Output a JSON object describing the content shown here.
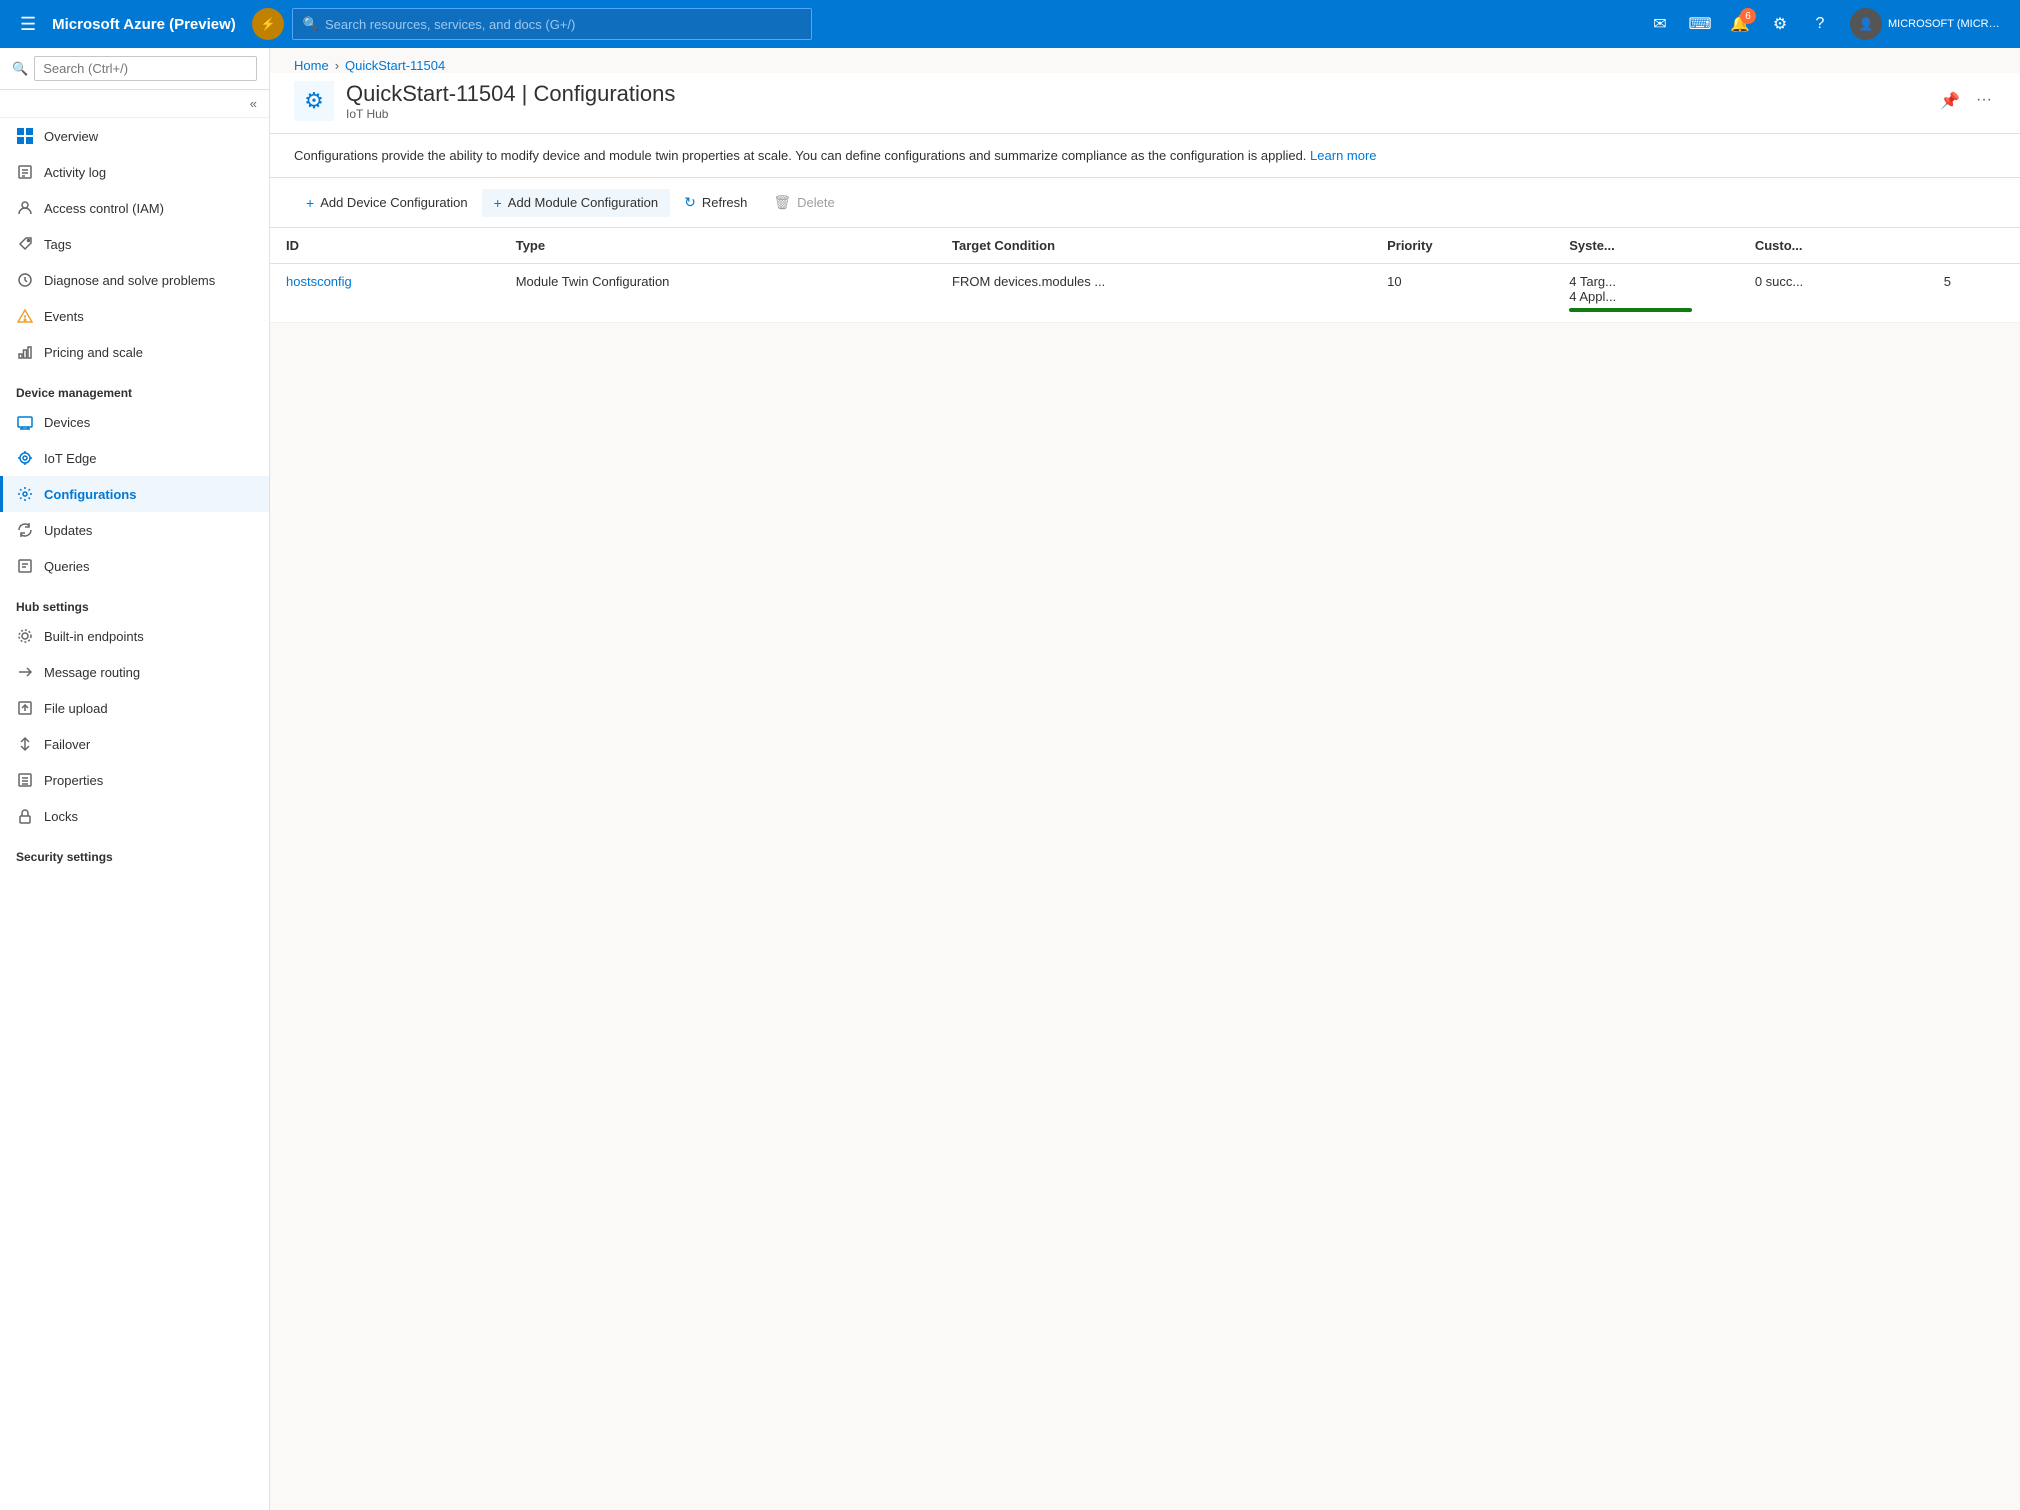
{
  "topnav": {
    "brand": "Microsoft Azure (Preview)",
    "search_placeholder": "Search resources, services, and docs (G+/)",
    "notification_count": "6",
    "user_label": "MICROSOFT (MICROSOFT.ON"
  },
  "breadcrumb": {
    "home": "Home",
    "resource": "QuickStart-11504"
  },
  "page": {
    "title": "QuickStart-11504 | Configurations",
    "subtitle": "IoT Hub"
  },
  "info": {
    "text": "Configurations provide the ability to modify device and module twin properties at scale. You can define configurations and summarize compliance as the configuration is applied.",
    "learn_more": "Learn more"
  },
  "toolbar": {
    "add_device_config": "Add Device Configuration",
    "add_module_config": "Add Module Configuration",
    "refresh": "Refresh",
    "delete": "Delete"
  },
  "table": {
    "columns": [
      "ID",
      "Type",
      "Target Condition",
      "Priority",
      "Syste...",
      "Custo...",
      ""
    ],
    "rows": [
      {
        "id": "hostsconfig",
        "type": "Module Twin Configuration",
        "target_condition": "FROM devices.modules ...",
        "priority": "10",
        "syste_line1": "4 Targ...",
        "syste_line2": "4 Appl...",
        "custo": "0 succ...",
        "extra": "5"
      }
    ]
  },
  "sidebar": {
    "search_placeholder": "Search (Ctrl+/)",
    "items": [
      {
        "id": "overview",
        "label": "Overview",
        "icon": "⊞"
      },
      {
        "id": "activity-log",
        "label": "Activity log",
        "icon": "📋"
      },
      {
        "id": "access-control",
        "label": "Access control (IAM)",
        "icon": "👥"
      },
      {
        "id": "tags",
        "label": "Tags",
        "icon": "🏷"
      },
      {
        "id": "diagnose",
        "label": "Diagnose and solve problems",
        "icon": "🔧"
      },
      {
        "id": "events",
        "label": "Events",
        "icon": "⚡"
      },
      {
        "id": "pricing",
        "label": "Pricing and scale",
        "icon": "📊"
      }
    ],
    "section_device": "Device management",
    "device_items": [
      {
        "id": "devices",
        "label": "Devices",
        "icon": "🖥"
      },
      {
        "id": "iot-edge",
        "label": "IoT Edge",
        "icon": "☁"
      },
      {
        "id": "configurations",
        "label": "Configurations",
        "icon": "⚙",
        "active": true
      },
      {
        "id": "updates",
        "label": "Updates",
        "icon": "🔄"
      },
      {
        "id": "queries",
        "label": "Queries",
        "icon": "📄"
      }
    ],
    "section_hub": "Hub settings",
    "hub_items": [
      {
        "id": "built-in-endpoints",
        "label": "Built-in endpoints",
        "icon": "🔌"
      },
      {
        "id": "message-routing",
        "label": "Message routing",
        "icon": "↗"
      },
      {
        "id": "file-upload",
        "label": "File upload",
        "icon": "📁"
      },
      {
        "id": "failover",
        "label": "Failover",
        "icon": "↕"
      },
      {
        "id": "properties",
        "label": "Properties",
        "icon": "📝"
      },
      {
        "id": "locks",
        "label": "Locks",
        "icon": "🔒"
      }
    ],
    "section_security": "Security settings"
  }
}
